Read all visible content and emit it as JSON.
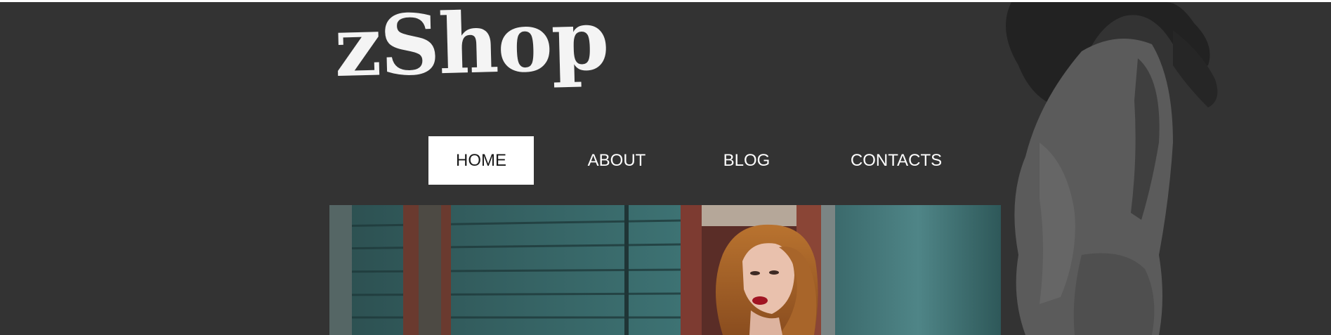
{
  "brand": {
    "logo_text": "zShop"
  },
  "nav": {
    "items": [
      {
        "label": "HOME",
        "active": true
      },
      {
        "label": "ABOUT",
        "active": false
      },
      {
        "label": "BLOG",
        "active": false
      },
      {
        "label": "CONTACTS",
        "active": false
      }
    ]
  },
  "colors": {
    "background": "#333333",
    "nav_active_bg": "#ffffff",
    "nav_text": "#ffffff",
    "wall_teal": "#3f6f70",
    "door_red": "#7a3a30"
  },
  "hero": {
    "image": "woman-red-hair-by-teal-wooden-wall"
  },
  "decor": {
    "image": "grayscale-woman-silhouette"
  }
}
